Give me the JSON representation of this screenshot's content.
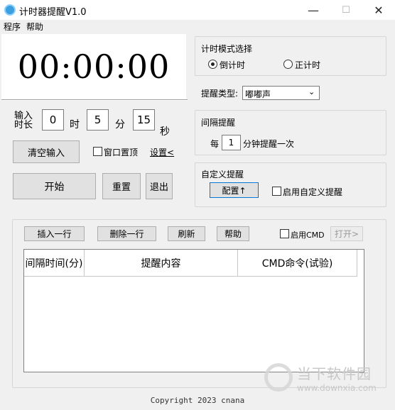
{
  "window": {
    "title": "计时器提醒V1.0",
    "minimize": "—",
    "maximize": "☐",
    "close": "✕"
  },
  "menu": [
    "程序",
    "帮助"
  ],
  "timer": {
    "display": "00:00:00"
  },
  "duration": {
    "label_line1": "输入",
    "label_line2": "时长",
    "hours": "0",
    "hours_unit": "时",
    "minutes": "5",
    "minutes_unit": "分",
    "seconds": "15",
    "seconds_unit": "秒"
  },
  "controls": {
    "clear_label": "清空输入",
    "topmost_label": "窗口置顶",
    "topmost_checked": false,
    "settings_label": "设置<",
    "start_label": "开始",
    "reset_label": "重置",
    "exit_label": "退出"
  },
  "mode": {
    "title": "计时模式选择",
    "countdown_label": "倒计时",
    "countup_label": "正计时",
    "selected": "countdown"
  },
  "reminder_type": {
    "label": "提醒类型:",
    "value": "嘟嘟声"
  },
  "interval": {
    "title": "间隔提醒",
    "prefix": "每",
    "value": "1",
    "suffix": "分钟提醒一次"
  },
  "custom": {
    "title": "自定义提醒",
    "config_label": "配置↑",
    "enable_label": "启用自定义提醒",
    "enabled": false
  },
  "table_toolbar": {
    "insert_label": "插入一行",
    "delete_label": "删除一行",
    "refresh_label": "刷新",
    "help_label": "帮助",
    "cmd_label": "启用CMD",
    "open_label": "打开>"
  },
  "table": {
    "columns": [
      "间隔时间(分)",
      "提醒内容",
      "CMD命令(试验)"
    ],
    "rows": []
  },
  "footer": {
    "copyright": "Copyright 2023 cnana"
  },
  "watermark": {
    "name": "当下软件园",
    "url": "www.downxia.com"
  }
}
